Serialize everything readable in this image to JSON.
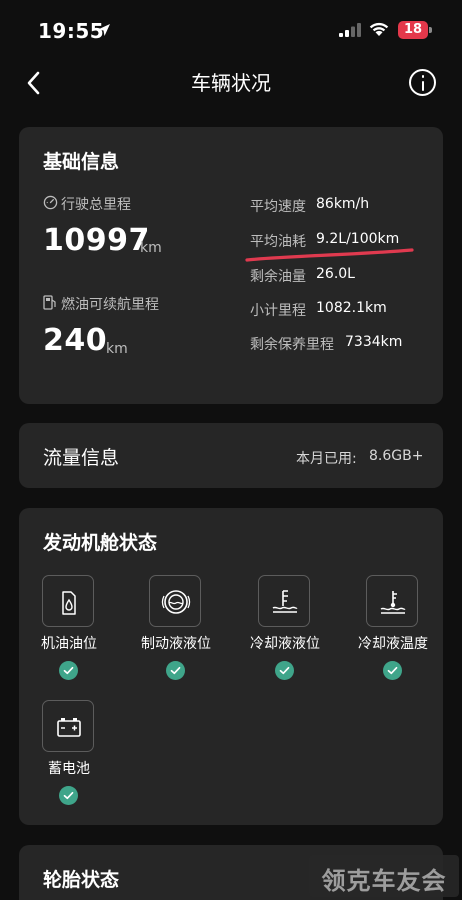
{
  "status_bar": {
    "time": "19:55",
    "battery_level": "18",
    "battery_color": "#e4384b"
  },
  "nav": {
    "title": "车辆状况",
    "back_icon": "chevron-left-icon",
    "info_icon": "info-icon"
  },
  "basic_info": {
    "title": "基础信息",
    "total_mileage": {
      "label": "行驶总里程",
      "value": "10997",
      "unit": "km",
      "icon": "odometer-icon"
    },
    "range": {
      "label": "燃油可续航里程",
      "value": "240",
      "unit": "km",
      "icon": "fuel-pump-icon"
    },
    "stats": [
      {
        "label": "平均速度",
        "value": "86km/h"
      },
      {
        "label": "平均油耗",
        "value": "9.2L/100km"
      },
      {
        "label": "剩余油量",
        "value": "26.0L"
      },
      {
        "label": "小计里程",
        "value": "1082.1km"
      },
      {
        "label": "剩余保养里程",
        "value": "7334km"
      }
    ],
    "highlight_color": "#e03a4f"
  },
  "traffic": {
    "title": "流量信息",
    "used_label": "本月已用:",
    "used_value": "8.6GB+"
  },
  "engine": {
    "title": "发动机舱状态",
    "items": [
      {
        "label": "机油油位",
        "icon": "oil-can-icon",
        "status": "ok"
      },
      {
        "label": "制动液液位",
        "icon": "brake-fluid-icon",
        "status": "ok"
      },
      {
        "label": "冷却液液位",
        "icon": "coolant-level-icon",
        "status": "ok"
      },
      {
        "label": "冷却液温度",
        "icon": "coolant-temp-icon",
        "status": "ok"
      },
      {
        "label": "蓄电池",
        "icon": "battery-icon",
        "status": "ok"
      }
    ],
    "ok_color": "#3fa58a"
  },
  "tire": {
    "title": "轮胎状态"
  },
  "watermark": "领克车友会"
}
